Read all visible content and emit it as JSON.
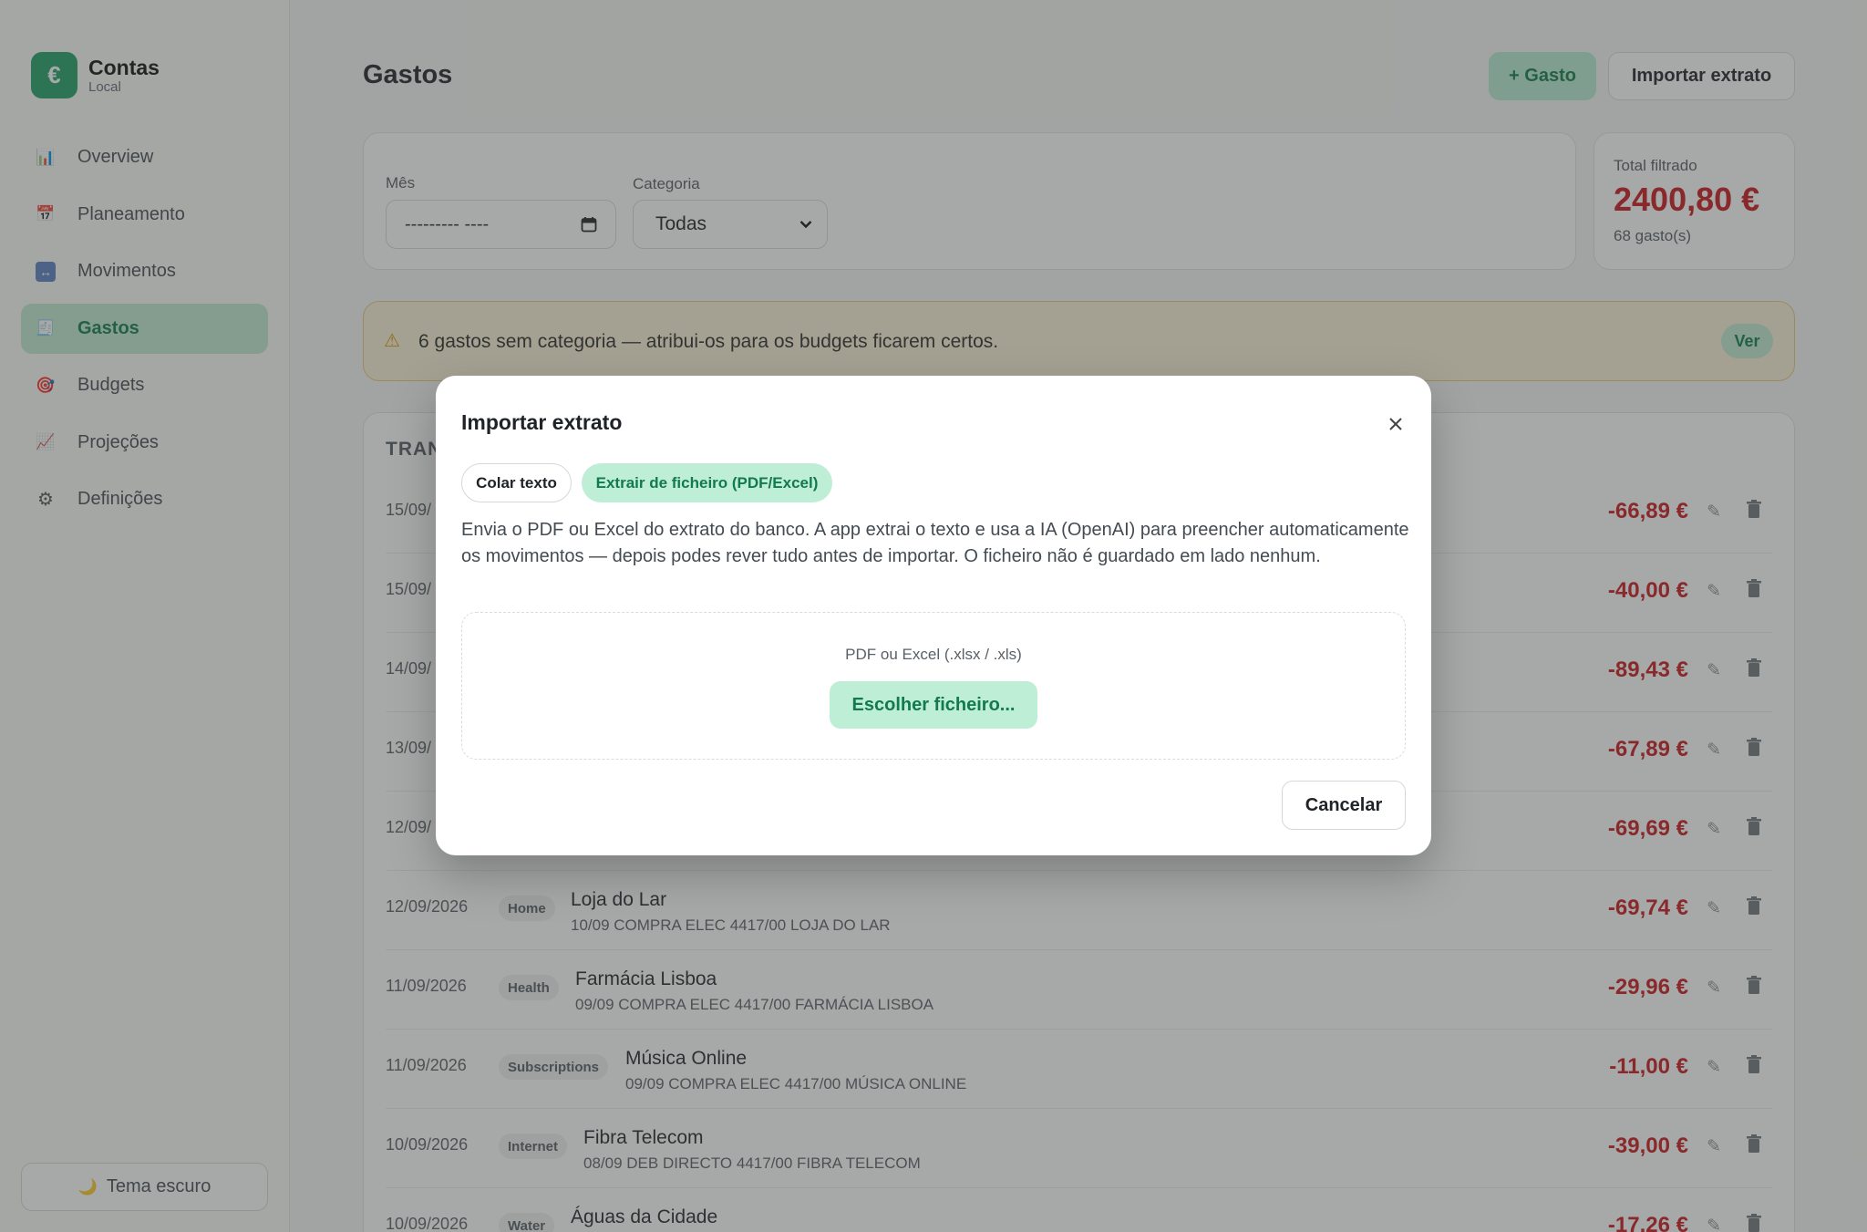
{
  "app": {
    "name": "Contas",
    "subtitle": "Local",
    "logo_glyph": "€",
    "accent": "#1f9f66"
  },
  "sidebar": {
    "items": [
      {
        "label": "Overview",
        "icon": "bar-chart-icon",
        "glyph": "📊"
      },
      {
        "label": "Planeamento",
        "icon": "calendar-icon",
        "glyph": "📅"
      },
      {
        "label": "Movimentos",
        "icon": "swap-arrows-icon",
        "glyph": "↔"
      },
      {
        "label": "Gastos",
        "icon": "receipt-icon",
        "glyph": "🧾",
        "active": true
      },
      {
        "label": "Budgets",
        "icon": "target-icon",
        "glyph": "🎯"
      },
      {
        "label": "Projeções",
        "icon": "trend-up-icon",
        "glyph": "📈"
      },
      {
        "label": "Definições",
        "icon": "gear-icon",
        "glyph": "⚙"
      }
    ],
    "theme_toggle": {
      "label": "Tema escuro",
      "glyph": "🌙"
    }
  },
  "header": {
    "title": "Gastos",
    "add_label": "+ Gasto",
    "import_label": "Importar extrato"
  },
  "filters": {
    "month_label": "Mês",
    "month_value": "--------- ----",
    "category_label": "Categoria",
    "category_value": "Todas"
  },
  "total": {
    "label": "Total filtrado",
    "value": "2400,80 €",
    "count": "68 gasto(s)",
    "color": "#c8171c"
  },
  "warning": {
    "text": "6 gastos sem categoria — atribui-os para os budgets ficarem certos.",
    "button": "Ver"
  },
  "table": {
    "title_visible": "TRAN",
    "hidden_rows": [
      {
        "date": "15/09/",
        "amount": "-66,89 €"
      },
      {
        "date": "15/09/",
        "amount": "-40,00 €"
      },
      {
        "date": "14/09/",
        "amount": "-89,43 €"
      },
      {
        "date": "13/09/",
        "amount": "-67,89 €"
      },
      {
        "date": "12/09/",
        "amount": "-69,69 €"
      }
    ],
    "rows": [
      {
        "date": "12/09/2026",
        "category": "Home",
        "title": "Loja do Lar",
        "sub": "10/09 COMPRA ELEC 4417/00 LOJA DO LAR",
        "amount": "-69,74 €"
      },
      {
        "date": "11/09/2026",
        "category": "Health",
        "title": "Farmácia Lisboa",
        "sub": "09/09 COMPRA ELEC 4417/00 FARMÁCIA LISBOA",
        "amount": "-29,96 €"
      },
      {
        "date": "11/09/2026",
        "category": "Subscriptions",
        "title": "Música Online",
        "sub": "09/09 COMPRA ELEC 4417/00 MÚSICA ONLINE",
        "amount": "-11,00 €"
      },
      {
        "date": "10/09/2026",
        "category": "Internet",
        "title": "Fibra Telecom",
        "sub": "08/09 DEB DIRECTO 4417/00 FIBRA TELECOM",
        "amount": "-39,00 €"
      },
      {
        "date": "10/09/2026",
        "category": "Water",
        "title": "Águas da Cidade",
        "sub": "",
        "amount": "-17,26 €"
      }
    ]
  },
  "modal": {
    "title": "Importar extrato",
    "tabs": [
      {
        "label": "Colar texto"
      },
      {
        "label": "Extrair de ficheiro (PDF/Excel)",
        "active": true
      }
    ],
    "description": "Envia o PDF ou Excel do extrato do banco. A app extrai o texto e usa a IA (OpenAI) para preencher automaticamente os movimentos — depois podes rever tudo antes de importar. O ficheiro não é guardado em lado nenhum.",
    "dropzone_label": "PDF ou Excel (.xlsx / .xls)",
    "choose_button": "Escolher ficheiro...",
    "cancel_button": "Cancelar"
  }
}
